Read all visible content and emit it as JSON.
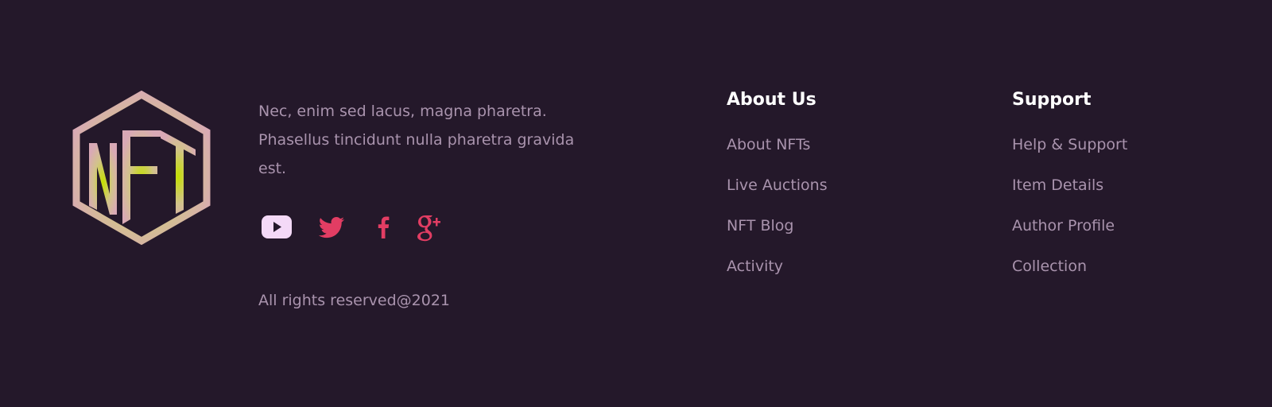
{
  "brand": {
    "logo_text": "NFT"
  },
  "footer": {
    "tagline": "Nec, enim sed lacus, magna pharetra. Phasellus tincidunt nulla pharetra gravida est.",
    "copyright": "All rights reserved@2021",
    "social": [
      {
        "icon": "youtube-icon",
        "color": "#f4d9f7"
      },
      {
        "icon": "twitter-icon",
        "color": "#e23d63"
      },
      {
        "icon": "facebook-icon",
        "color": "#e23d63"
      },
      {
        "icon": "google-plus-icon",
        "color": "#e23d63"
      }
    ]
  },
  "columns": {
    "about": {
      "title": "About Us",
      "links": [
        "About NFTs",
        "Live Auctions",
        "NFT Blog",
        "Activity"
      ]
    },
    "support": {
      "title": "Support",
      "links": [
        "Help & Support",
        "Item Details",
        "Author Profile",
        "Collection"
      ]
    }
  },
  "colors": {
    "background": "#24182a",
    "muted_text": "#a993ad",
    "heading": "#ffffff",
    "accent": "#e23d63",
    "logo_gradient_start": "#d9a9b6",
    "logo_gradient_center": "#c4e000"
  }
}
